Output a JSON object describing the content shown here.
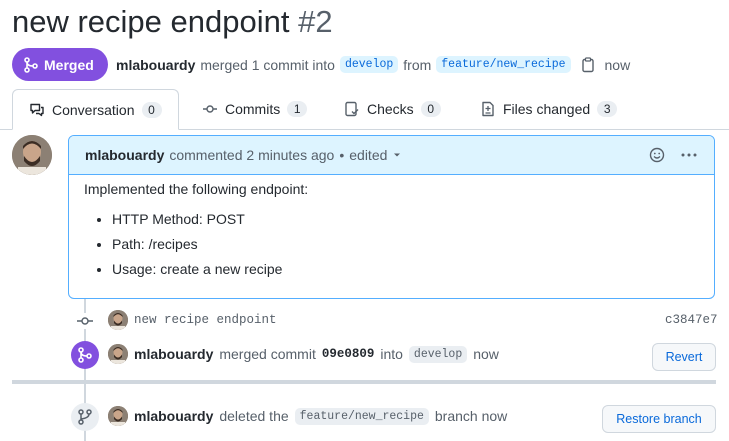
{
  "pr": {
    "title": "new recipe endpoint",
    "number": "#2",
    "state_label": "Merged",
    "author": "mlabouardy",
    "merged_text": "merged 1 commit into",
    "base_branch": "develop",
    "from_text": "from",
    "head_branch": "feature/new_recipe",
    "time": "now"
  },
  "tabs": [
    {
      "label": "Conversation",
      "count": "0"
    },
    {
      "label": "Commits",
      "count": "1"
    },
    {
      "label": "Checks",
      "count": "0"
    },
    {
      "label": "Files changed",
      "count": "3"
    }
  ],
  "comment": {
    "author": "mlabouardy",
    "action": "commented 2 minutes ago",
    "dot": "•",
    "edited": "edited",
    "intro": "Implemented the following endpoint:",
    "items": [
      "HTTP Method: POST",
      "Path: /recipes",
      "Usage: create a new recipe"
    ]
  },
  "commit": {
    "message": "new recipe endpoint",
    "sha": "c3847e7"
  },
  "merge_event": {
    "author": "mlabouardy",
    "text": "merged commit",
    "sha": "09e0809",
    "into": "into",
    "branch": "develop",
    "time": "now",
    "button": "Revert"
  },
  "delete_event": {
    "author": "mlabouardy",
    "text": "deleted the",
    "branch": "feature/new_recipe",
    "suffix": "branch now",
    "button": "Restore branch"
  },
  "colors": {
    "merged": "#8250df",
    "link": "#0969da",
    "comment_border": "#54aeff",
    "comment_head_bg": "#ddf4ff"
  }
}
